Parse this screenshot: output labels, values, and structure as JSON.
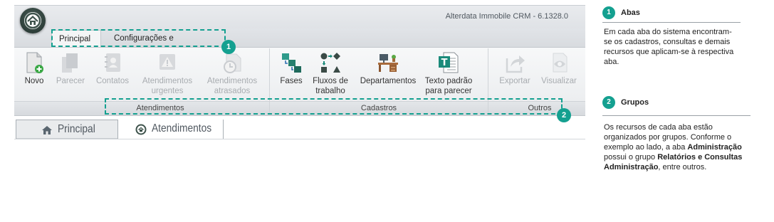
{
  "window": {
    "title": "Alterdata Immobile CRM - 6.1328.0",
    "tabs": [
      {
        "label": "Principal",
        "active": true
      },
      {
        "label": "Configurações e Manutenção",
        "active": false
      }
    ]
  },
  "ribbon": {
    "groups": [
      {
        "label": "Atendimentos",
        "buttons": [
          {
            "label": "Novo",
            "icon": "new-document-icon",
            "enabled": true
          },
          {
            "label": "Parecer",
            "icon": "copy-pages-icon",
            "enabled": false
          },
          {
            "label": "Contatos",
            "icon": "address-book-icon",
            "enabled": false
          },
          {
            "label": "Atendimentos urgentes",
            "icon": "warning-icon",
            "enabled": false
          },
          {
            "label": "Atendimentos atrasados",
            "icon": "clock-icon",
            "enabled": false
          }
        ]
      },
      {
        "label": "Cadastros",
        "buttons": [
          {
            "label": "Fases",
            "icon": "phases-icon",
            "enabled": true
          },
          {
            "label": "Fluxos de trabalho",
            "icon": "workflow-icon",
            "enabled": true
          },
          {
            "label": "Departamentos",
            "icon": "department-desk-icon",
            "enabled": true
          },
          {
            "label": "Texto padrão para parecer",
            "icon": "text-template-icon",
            "enabled": true
          }
        ]
      },
      {
        "label": "Outros",
        "buttons": [
          {
            "label": "Exportar",
            "icon": "export-icon",
            "enabled": false
          },
          {
            "label": "Visualizar",
            "icon": "eye-icon",
            "enabled": false
          }
        ]
      }
    ]
  },
  "callouts": [
    {
      "number": "1"
    },
    {
      "number": "2"
    }
  ],
  "document_tabs": [
    {
      "label": "Principal",
      "icon": "home-icon",
      "active": true
    },
    {
      "label": "Atendimentos",
      "icon": "app-logo-icon",
      "active": false
    }
  ],
  "help": {
    "sections": [
      {
        "number": "1",
        "title": "Abas",
        "text": "Em cada aba do sistema encontram-se os cadastros, consultas e demais recursos que aplicam-se à respectiva aba."
      },
      {
        "number": "2",
        "title": "Grupos",
        "text_parts": [
          "Os recursos de cada aba estão organizados por grupos. Conforme o exemplo ao lado, a aba ",
          "Administração",
          " possui o grupo ",
          "Relatórios e Consultas Administração",
          ", entre outros."
        ]
      }
    ]
  },
  "colors": {
    "accent": "#14a090",
    "ribbon_bg": "#eceef0",
    "disabled_text": "#a8acb0"
  }
}
